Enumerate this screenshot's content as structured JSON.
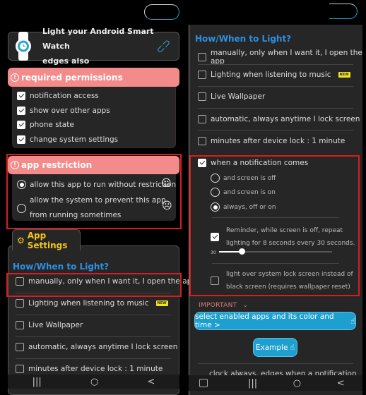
{
  "left": {
    "watch_card": {
      "line1": "Light your Android Smart Watch",
      "line2": "edges also",
      "icon": "watch-icon",
      "action_icon": "link-icon"
    },
    "permissions": {
      "title": "required permissions",
      "items": [
        {
          "label": "notification access",
          "checked": true
        },
        {
          "label": "show over other apps",
          "checked": true
        },
        {
          "label": "phone state",
          "checked": true
        },
        {
          "label": "change system settings",
          "checked": true
        }
      ]
    },
    "restriction": {
      "title": "app restriction",
      "options": [
        {
          "label": "allow this app to run without restriction",
          "selected": true,
          "icon": "☺"
        },
        {
          "label_line1": "allow the system to prevent this app",
          "label_line2": "from running sometimes",
          "selected": false,
          "icon": "☹"
        }
      ]
    },
    "app_settings": {
      "tab_label": "App Settings",
      "how_title": "How/When to Light?",
      "items": [
        {
          "label": "manually, only when I want it, I open the app",
          "checked": false
        },
        {
          "label": "Lighting when listening to music",
          "checked": false,
          "badge": "NEW"
        },
        {
          "label": "Live Wallpaper",
          "checked": false
        },
        {
          "label": "automatic, always anytime I lock screen",
          "checked": false
        },
        {
          "label": "minutes after device lock : 1 minute",
          "checked": false
        }
      ]
    }
  },
  "right": {
    "how_title": "How/When to Light?",
    "items": [
      {
        "label": "manually, only when I want it, I open the app",
        "checked": false
      },
      {
        "label": "Lighting when listening to music",
        "checked": false,
        "badge": "NEW"
      },
      {
        "label": "Live Wallpaper",
        "checked": false
      },
      {
        "label": "automatic, always anytime I lock screen",
        "checked": false
      },
      {
        "label": "minutes after device lock : 1 minute",
        "checked": false
      }
    ],
    "notification": {
      "label": "when a notification comes",
      "checked": true,
      "options": [
        {
          "label": "and screen is off",
          "selected": false
        },
        {
          "label": "and screen is on",
          "selected": false
        },
        {
          "label": "always, off or on",
          "selected": true
        }
      ],
      "reminder": {
        "line1": "Reminder, while screen is off, repeat",
        "line2": "lighting for 8 seconds every 30 seconds.",
        "checked": true,
        "slider_label": "30",
        "slider_fraction": 0.2
      },
      "lockscreen": {
        "line1": "light over system lock screen instead of",
        "line2": "black screen (requires wallpaper reset)",
        "checked": false
      }
    },
    "important_label": "IMPORTANT",
    "select_apps_button": "select enabled apps and its color and time >",
    "example_button": "Example",
    "partial_item": "clock always, edges when a notification"
  },
  "navbar": {
    "recents": "|||",
    "home": "○",
    "back": "<"
  },
  "colors": {
    "accent_blue": "#2e8fe0",
    "button_blue": "#1d9fcf",
    "header_pink": "#f38b8b",
    "highlight_red": "#d71d1d",
    "badge_yellow": "#f2e41a",
    "settings_gold": "#f5c518"
  }
}
